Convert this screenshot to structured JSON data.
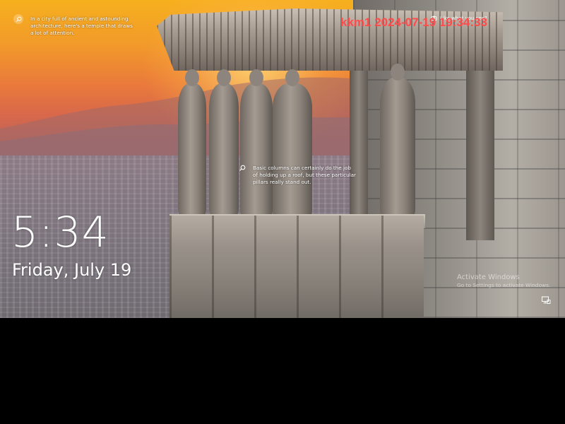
{
  "lockscreen": {
    "clock_time": "5:34",
    "clock_date": "Friday, July 19",
    "spotlight_tip_top": "In a city full of ancient and astounding architecture, here's a temple that draws a lot of attention.",
    "spotlight_tip_middle": "Basic columns can certainly do the job of holding up a roof, but these particular pillars really stand out.",
    "like_prompt": "Like what you see?",
    "activation_title": "Activate Windows",
    "activation_subtitle": "Go to Settings to activate Windows.",
    "tip_icons": [
      "magnifier-icon",
      "magnifier-icon"
    ],
    "status_icons": [
      "network-icon",
      "camera-icon"
    ]
  },
  "overlay": {
    "timestamp_watermark": "kkm1 2024-07-19 19:34:33",
    "watermark_color": "#ff4b4b"
  },
  "colors": {
    "background_bottom": "#000000",
    "text": "#ffffff"
  }
}
